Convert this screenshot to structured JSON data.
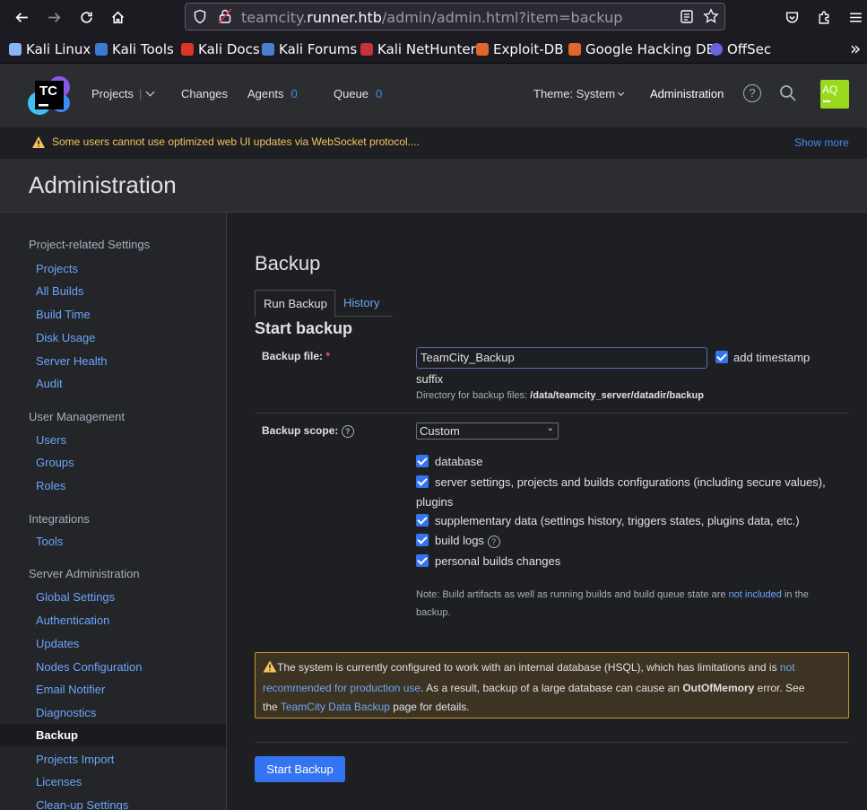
{
  "browser": {
    "url_prefix": "teamcity.",
    "url_host": "runner.htb",
    "url_path": "/admin/admin.html?item=backup",
    "bookmarks": [
      "Kali Linux",
      "Kali Tools",
      "Kali Docs",
      "Kali Forums",
      "Kali NetHunter",
      "Exploit-DB",
      "Google Hacking DB",
      "OffSec"
    ],
    "bookmark_more": "»"
  },
  "header": {
    "logo_text": "TC",
    "projects": "Projects",
    "changes": "Changes",
    "agents": "Agents",
    "agents_count": "0",
    "queue": "Queue",
    "queue_count": "0",
    "theme": "Theme: System",
    "administration": "Administration",
    "avatar": "AQ"
  },
  "warning_bar": {
    "text": "Some users cannot use optimized web UI updates via WebSocket protocol....",
    "show_more": "Show more"
  },
  "page_title": "Administration",
  "sidebar": {
    "groups": [
      {
        "title": "Project-related Settings",
        "items": [
          "Projects",
          "All Builds",
          "Build Time",
          "Disk Usage",
          "Server Health",
          "Audit"
        ]
      },
      {
        "title": "User Management",
        "items": [
          "Users",
          "Groups",
          "Roles"
        ]
      },
      {
        "title": "Integrations",
        "items": [
          "Tools"
        ]
      },
      {
        "title": "Server Administration",
        "items": [
          "Global Settings",
          "Authentication",
          "Updates",
          "Nodes Configuration",
          "Email Notifier",
          "Diagnostics",
          "Backup",
          "Projects Import",
          "Licenses",
          "Clean-up Settings"
        ]
      }
    ],
    "active_item": "Backup"
  },
  "main": {
    "title": "Backup",
    "tabs": [
      "Run Backup",
      "History"
    ],
    "section_title": "Start backup",
    "backup_file_label": "Backup file:",
    "required_mark": "*",
    "backup_file_value": "TeamCity_Backup",
    "add_timestamp": "add timestamp",
    "suffix": "suffix",
    "directory_label": "Directory for backup files:",
    "directory_path": "/data/teamcity_server/datadir/backup",
    "scope_label": "Backup scope:",
    "scope_value": "Custom",
    "scope_options": {
      "database": "database",
      "server_settings_1": "server settings, projects and builds configurations (including secure values),",
      "server_settings_2": "plugins",
      "supplementary": "supplementary data (settings history, triggers states, plugins data, etc.)",
      "build_logs": "build logs",
      "personal_builds": "personal builds changes"
    },
    "note_prefix": "Note: Build artifacts as well as running builds and build queue state are",
    "note_link": "not included",
    "note_suffix_1": "in the",
    "note_suffix_2": "backup.",
    "warn_part1": "The system is currently configured to work with an internal database (HSQL), which has limitations and is",
    "warn_link1a": "not",
    "warn_link1b": "recommended for production use",
    "warn_part2": ". As a result, backup of a large database can cause an",
    "warn_bold": "OutOfMemory",
    "warn_part3": "error. See",
    "warn_part4": "the",
    "warn_link2": "TeamCity Data Backup",
    "warn_part5": "page for details.",
    "start_button": "Start Backup"
  },
  "colors": {
    "accent": "#3574f0",
    "link": "#6aa6f8",
    "warning": "#f2c55c",
    "avatar": "#9bd91e"
  }
}
